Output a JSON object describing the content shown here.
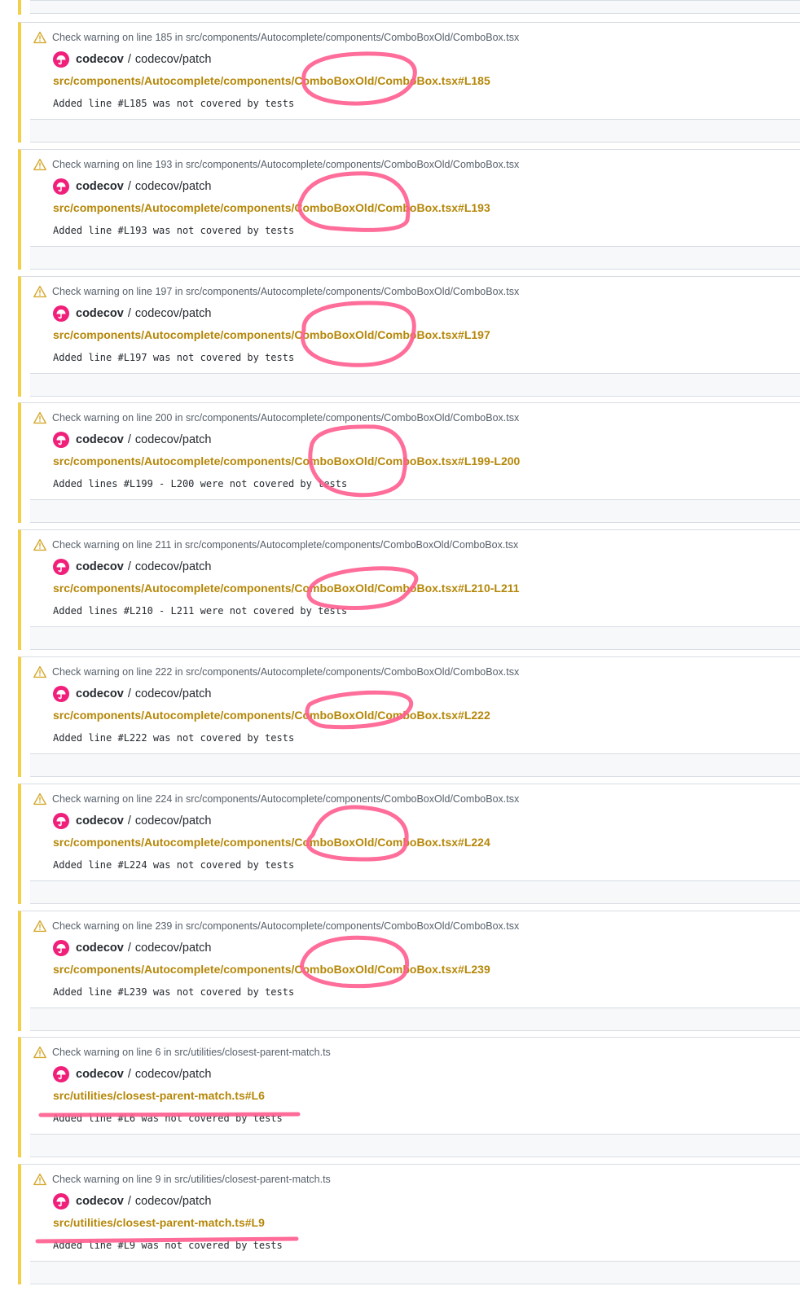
{
  "colors": {
    "accent_bar": "#f3ce49",
    "file_link": "#b58708",
    "warning_icon": "#d4a72c",
    "annotation_ink": "#ff5d8f",
    "codecov_badge": "#f01f7a"
  },
  "icons": {
    "warning": "alert-triangle-icon",
    "app": "codecov-umbrella-icon"
  },
  "checks": [
    {
      "warning": "Check warning on line 185 in src/components/Autocomplete/components/ComboBoxOld/ComboBox.tsx",
      "app_name": "codecov",
      "separator": "/",
      "check_name": "codecov/patch",
      "file": "src/components/Autocomplete/components/ComboBoxOld/ComboBox.tsx#L185",
      "message": "Added line #L185 was not covered by tests"
    },
    {
      "warning": "Check warning on line 193 in src/components/Autocomplete/components/ComboBoxOld/ComboBox.tsx",
      "app_name": "codecov",
      "separator": "/",
      "check_name": "codecov/patch",
      "file": "src/components/Autocomplete/components/ComboBoxOld/ComboBox.tsx#L193",
      "message": "Added line #L193 was not covered by tests"
    },
    {
      "warning": "Check warning on line 197 in src/components/Autocomplete/components/ComboBoxOld/ComboBox.tsx",
      "app_name": "codecov",
      "separator": "/",
      "check_name": "codecov/patch",
      "file": "src/components/Autocomplete/components/ComboBoxOld/ComboBox.tsx#L197",
      "message": "Added line #L197 was not covered by tests"
    },
    {
      "warning": "Check warning on line 200 in src/components/Autocomplete/components/ComboBoxOld/ComboBox.tsx",
      "app_name": "codecov",
      "separator": "/",
      "check_name": "codecov/patch",
      "file": "src/components/Autocomplete/components/ComboBoxOld/ComboBox.tsx#L199-L200",
      "message": "Added lines #L199 - L200 were not covered by tests"
    },
    {
      "warning": "Check warning on line 211 in src/components/Autocomplete/components/ComboBoxOld/ComboBox.tsx",
      "app_name": "codecov",
      "separator": "/",
      "check_name": "codecov/patch",
      "file": "src/components/Autocomplete/components/ComboBoxOld/ComboBox.tsx#L210-L211",
      "message": "Added lines #L210 - L211 were not covered by tests"
    },
    {
      "warning": "Check warning on line 222 in src/components/Autocomplete/components/ComboBoxOld/ComboBox.tsx",
      "app_name": "codecov",
      "separator": "/",
      "check_name": "codecov/patch",
      "file": "src/components/Autocomplete/components/ComboBoxOld/ComboBox.tsx#L222",
      "message": "Added line #L222 was not covered by tests"
    },
    {
      "warning": "Check warning on line 224 in src/components/Autocomplete/components/ComboBoxOld/ComboBox.tsx",
      "app_name": "codecov",
      "separator": "/",
      "check_name": "codecov/patch",
      "file": "src/components/Autocomplete/components/ComboBoxOld/ComboBox.tsx#L224",
      "message": "Added line #L224 was not covered by tests"
    },
    {
      "warning": "Check warning on line 239 in src/components/Autocomplete/components/ComboBoxOld/ComboBox.tsx",
      "app_name": "codecov",
      "separator": "/",
      "check_name": "codecov/patch",
      "file": "src/components/Autocomplete/components/ComboBoxOld/ComboBox.tsx#L239",
      "message": "Added line #L239 was not covered by tests"
    },
    {
      "warning": "Check warning on line 6 in src/utilities/closest-parent-match.ts",
      "app_name": "codecov",
      "separator": "/",
      "check_name": "codecov/patch",
      "file": "src/utilities/closest-parent-match.ts#L6",
      "message": "Added line #L6 was not covered by tests"
    },
    {
      "warning": "Check warning on line 9 in src/utilities/closest-parent-match.ts",
      "app_name": "codecov",
      "separator": "/",
      "check_name": "codecov/patch",
      "file": "src/utilities/closest-parent-match.ts#L9",
      "message": "Added line #L9 was not covered by tests"
    }
  ]
}
